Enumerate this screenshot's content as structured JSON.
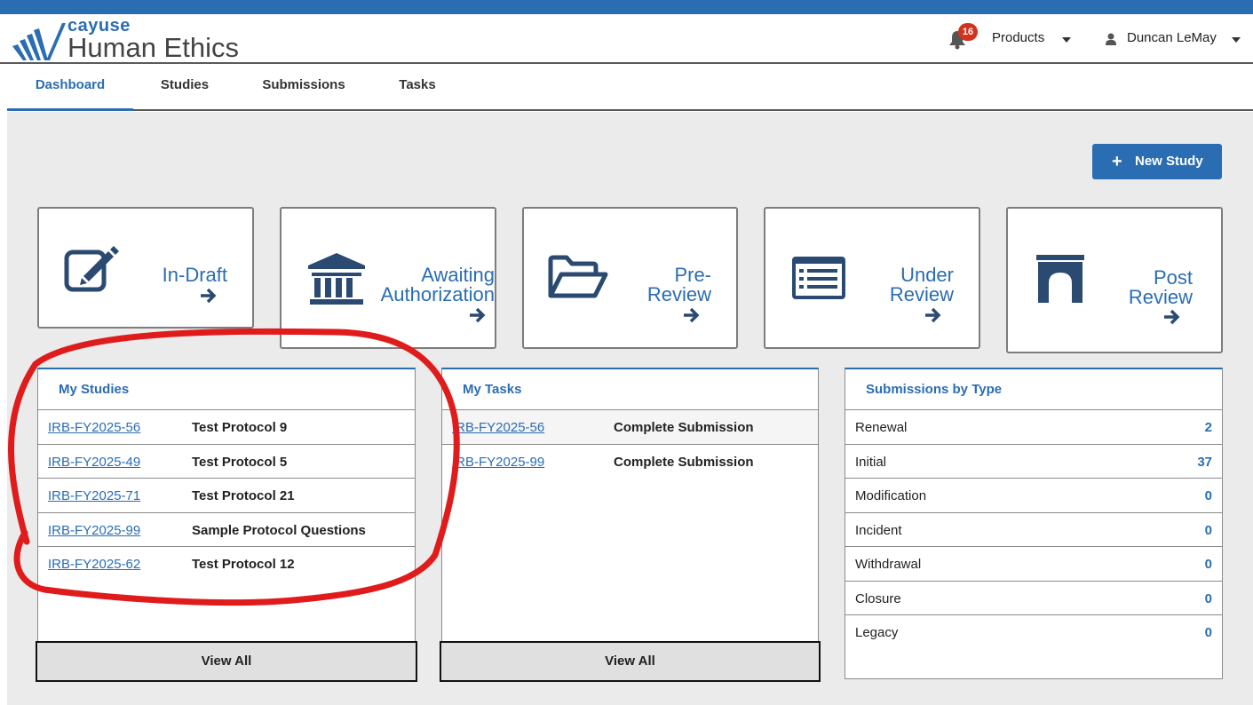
{
  "app": {
    "logo_small": "cayuse",
    "logo_big": "Human Ethics",
    "brand_color": "#2a6db3"
  },
  "header": {
    "notification_count": "16",
    "products_label": "Products",
    "user_name": "Duncan LeMay"
  },
  "nav": {
    "tabs": [
      {
        "label": "Dashboard",
        "active": true
      },
      {
        "label": "Studies"
      },
      {
        "label": "Submissions"
      },
      {
        "label": "Tasks"
      }
    ]
  },
  "actions": {
    "new_study_label": "New Study"
  },
  "tiles": [
    {
      "line1": "In-Draft",
      "line2": "",
      "icon": "edit-icon"
    },
    {
      "line1": "Awaiting",
      "line2": "Authorization",
      "icon": "institution-icon"
    },
    {
      "line1": "Pre-",
      "line2": "Review",
      "icon": "folder-open-icon"
    },
    {
      "line1": "Under",
      "line2": "Review",
      "icon": "list-alt-icon"
    },
    {
      "line1": "Post",
      "line2": "Review",
      "icon": "archway-icon"
    }
  ],
  "my_studies": {
    "title": "My Studies",
    "rows": [
      {
        "id": "IRB-FY2025-56",
        "name": "Test Protocol 9"
      },
      {
        "id": "IRB-FY2025-49",
        "name": "Test Protocol 5"
      },
      {
        "id": "IRB-FY2025-71",
        "name": "Test Protocol 21"
      },
      {
        "id": "IRB-FY2025-99",
        "name": "Sample Protocol Questions"
      },
      {
        "id": "IRB-FY2025-62",
        "name": "Test Protocol 12"
      }
    ],
    "view_all": "View All"
  },
  "my_tasks": {
    "title": "My Tasks",
    "rows": [
      {
        "id": "IRB-FY2025-56",
        "name": "Complete Submission"
      },
      {
        "id": "IRB-FY2025-99",
        "name": "Complete Submission"
      }
    ],
    "view_all": "View All"
  },
  "submissions_by_type": {
    "title": "Submissions by Type",
    "rows": [
      {
        "label": "Renewal",
        "count": "2"
      },
      {
        "label": "Initial",
        "count": "37"
      },
      {
        "label": "Modification",
        "count": "0"
      },
      {
        "label": "Incident",
        "count": "0"
      },
      {
        "label": "Withdrawal",
        "count": "0"
      },
      {
        "label": "Closure",
        "count": "0"
      },
      {
        "label": "Legacy",
        "count": "0"
      }
    ]
  },
  "annotation": {
    "color": "#e01b1b"
  }
}
